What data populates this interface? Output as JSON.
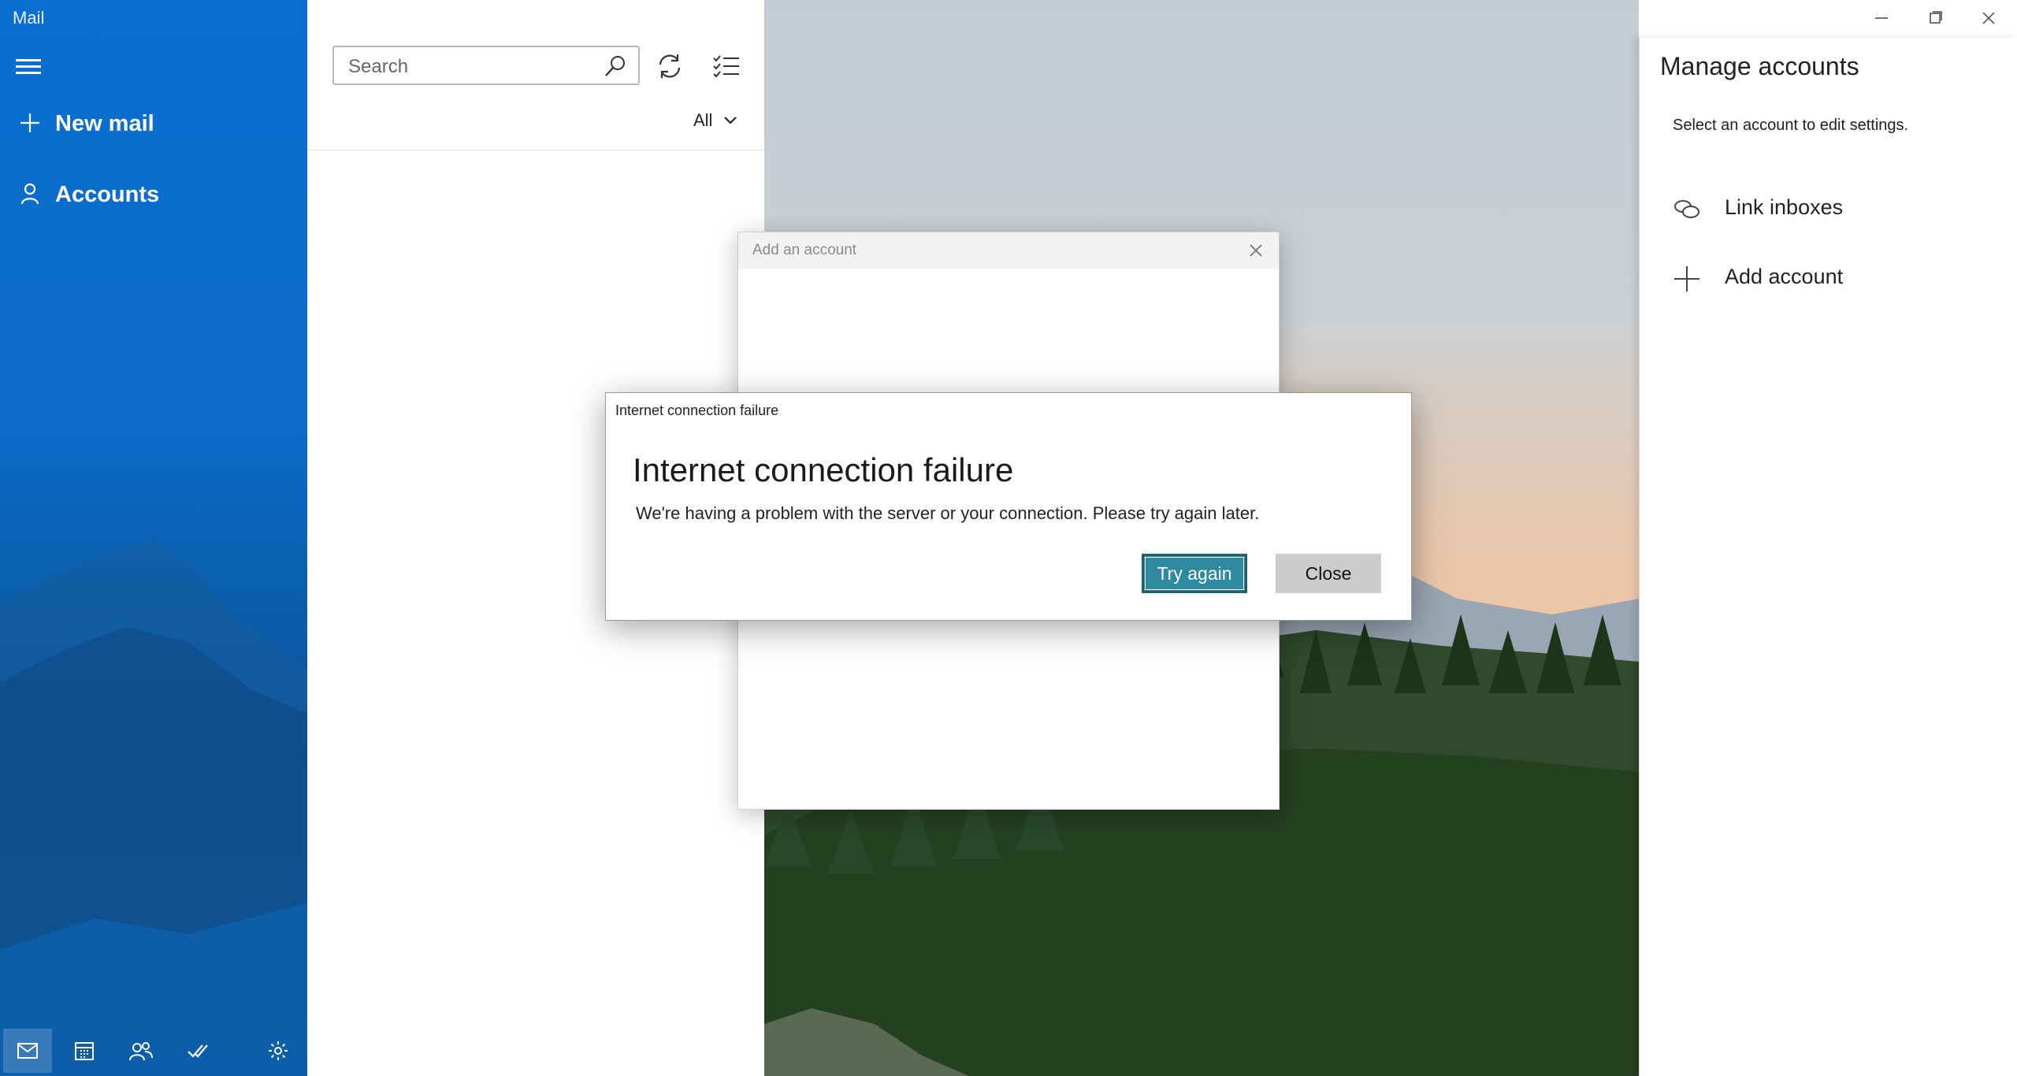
{
  "app": {
    "title": "Mail"
  },
  "sidebar": {
    "new_mail_label": "New mail",
    "accounts_label": "Accounts",
    "bottom_icons": [
      "mail-icon",
      "calendar-icon",
      "people-icon",
      "todo-icon",
      "settings-icon"
    ],
    "accent": "#0b6bc8"
  },
  "list": {
    "search_placeholder": "Search",
    "filter_label": "All"
  },
  "manage_accounts": {
    "title": "Manage accounts",
    "subtitle": "Select an account to edit settings.",
    "items": [
      {
        "label": "Link inboxes",
        "icon": "link-icon"
      },
      {
        "label": "Add account",
        "icon": "plus-icon"
      }
    ]
  },
  "add_account_dialog": {
    "title": "Add an account"
  },
  "error_dialog": {
    "caption": "Internet connection failure",
    "heading": "Internet connection failure",
    "message": "We're having a problem with the server or your connection. Please try again later.",
    "primary_button": "Try again",
    "secondary_button": "Close",
    "primary_color": "#2f8aa0"
  }
}
